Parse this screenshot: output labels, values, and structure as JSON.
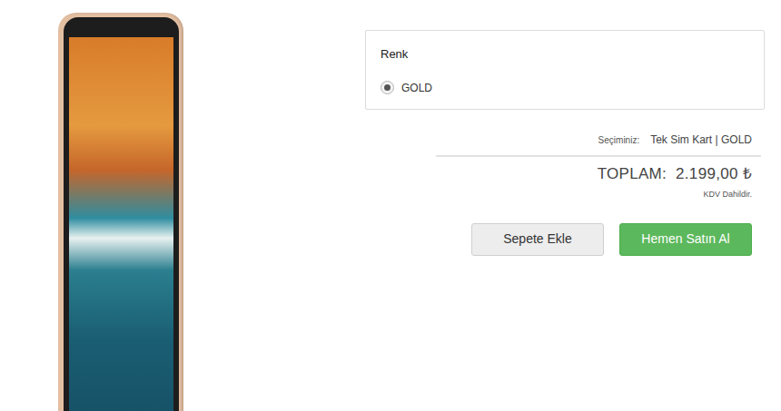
{
  "color_option": {
    "label": "Renk",
    "options": [
      {
        "label": "GOLD",
        "selected": true
      }
    ]
  },
  "selection": {
    "label": "Seçiminiz:",
    "value": "Tek Sim Kart | GOLD"
  },
  "total": {
    "label": "TOPLAM:",
    "amount": "2.199,00 ₺",
    "note": "KDV Dahildir."
  },
  "buttons": [
    {
      "label": "Sepete Ekle",
      "kind": "secondary"
    },
    {
      "label": "Hemen Satın Al",
      "kind": "primary"
    }
  ]
}
